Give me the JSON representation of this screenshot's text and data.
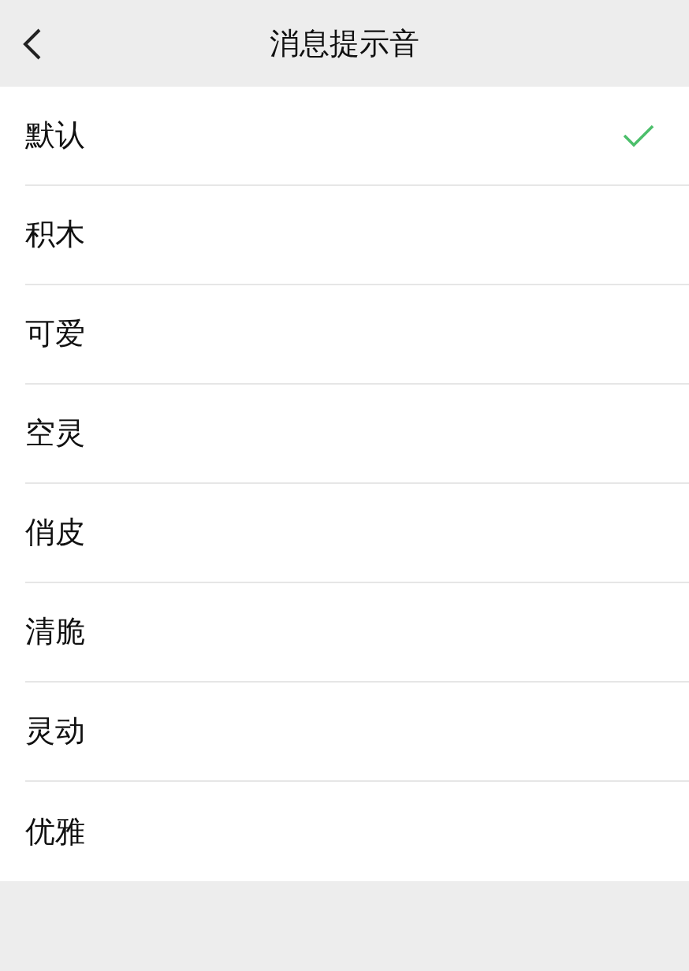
{
  "header": {
    "title": "消息提示音"
  },
  "items": [
    {
      "label": "默认",
      "selected": true
    },
    {
      "label": "积木",
      "selected": false
    },
    {
      "label": "可爱",
      "selected": false
    },
    {
      "label": "空灵",
      "selected": false
    },
    {
      "label": "俏皮",
      "selected": false
    },
    {
      "label": "清脆",
      "selected": false
    },
    {
      "label": "灵动",
      "selected": false
    },
    {
      "label": "优雅",
      "selected": false
    }
  ]
}
